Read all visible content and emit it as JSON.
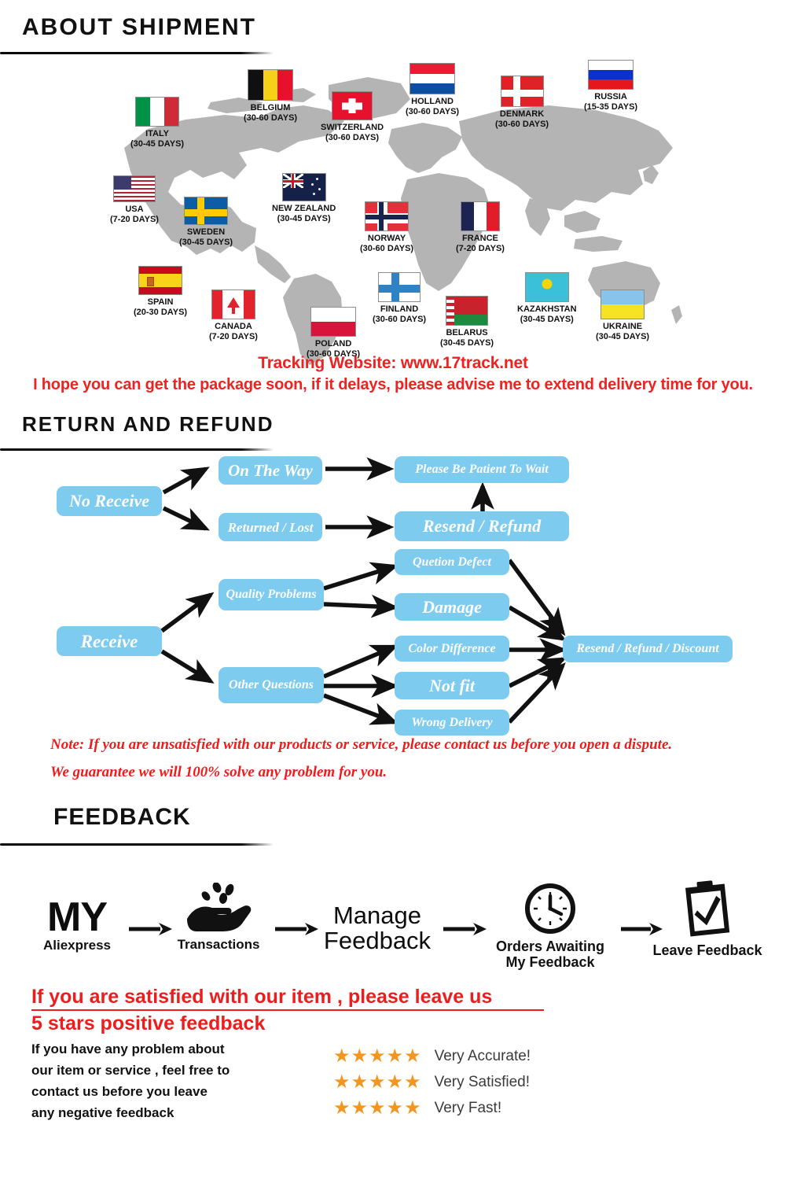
{
  "sections": {
    "shipment_title": "ABOUT  SHIPMENT",
    "return_title": "RETURN  AND  REFUND",
    "feedback_title": "FEEDBACK"
  },
  "shipment": {
    "tracking_line": "Tracking Website: www.17track.net",
    "hope_line": "I hope you can get the package soon, if it delays, please advise me to extend delivery time for you.",
    "destinations": [
      {
        "country": "ITALY",
        "days": "(30-45 DAYS)",
        "flag": "italy-flag"
      },
      {
        "country": "BELGIUM",
        "days": "(30-60 DAYS)",
        "flag": "belgium-flag"
      },
      {
        "country": "SWITZERLAND",
        "days": "(30-60 DAYS)",
        "flag": "switzerland-flag"
      },
      {
        "country": "HOLLAND",
        "days": "(30-60 DAYS)",
        "flag": "holland-flag"
      },
      {
        "country": "DENMARK",
        "days": "(30-60 DAYS)",
        "flag": "denmark-flag"
      },
      {
        "country": "RUSSIA",
        "days": "(15-35 DAYS)",
        "flag": "russia-flag"
      },
      {
        "country": "USA",
        "days": "(7-20 DAYS)",
        "flag": "usa-flag"
      },
      {
        "country": "SWEDEN",
        "days": "(30-45 DAYS)",
        "flag": "sweden-flag"
      },
      {
        "country": "NEW ZEALAND",
        "days": "(30-45 DAYS)",
        "flag": "new-zealand-flag"
      },
      {
        "country": "NORWAY",
        "days": "(30-60 DAYS)",
        "flag": "norway-flag"
      },
      {
        "country": "FRANCE",
        "days": "(7-20 DAYS)",
        "flag": "france-flag"
      },
      {
        "country": "SPAIN",
        "days": "(20-30 DAYS)",
        "flag": "spain-flag"
      },
      {
        "country": "CANADA",
        "days": "(7-20 DAYS)",
        "flag": "canada-flag"
      },
      {
        "country": "POLAND",
        "days": "(30-60 DAYS)",
        "flag": "poland-flag"
      },
      {
        "country": "FINLAND",
        "days": "(30-60 DAYS)",
        "flag": "finland-flag"
      },
      {
        "country": "BELARUS",
        "days": "(30-45 DAYS)",
        "flag": "belarus-flag"
      },
      {
        "country": "KAZAKHSTAN",
        "days": "(30-45 DAYS)",
        "flag": "kazakhstan-flag"
      },
      {
        "country": "UKRAINE",
        "days": "(30-45 DAYS)",
        "flag": "ukraine-flag"
      }
    ]
  },
  "flowchart": {
    "nodes": {
      "no_receive": "No Receive",
      "on_the_way": "On The Way",
      "returned_lost": "Returned / Lost",
      "please_wait": "Please Be Patient To Wait",
      "resend_refund": "Resend / Refund",
      "receive": "Receive",
      "quality_problems": "Quality Problems",
      "other_questions": "Other Questions",
      "quetion_defect": "Quetion Defect",
      "damage": "Damage",
      "color_difference": "Color Difference",
      "not_fit": "Not fit",
      "wrong_delivery": "Wrong Delivery",
      "resend_refund_discount": "Resend / Refund / Discount"
    },
    "note_line1": "Note: If you are unsatisfied with our products or service, please contact us before you open a dispute.",
    "note_line2": "We guarantee we will 100% solve any problem for you."
  },
  "feedback": {
    "steps": [
      {
        "big": "MY",
        "caption": "Aliexpress",
        "icon": "my-aliexpress-logo"
      },
      {
        "big": "",
        "caption": "Transactions",
        "icon": "hand-coins-icon"
      },
      {
        "big": "Manage",
        "caption": "Feedback",
        "icon": "manage-feedback-text"
      },
      {
        "big": "",
        "caption": "Orders Awaiting\nMy Feedback",
        "icon": "clock-icon"
      },
      {
        "big": "",
        "caption": "Leave Feedback",
        "icon": "clipboard-check-icon"
      }
    ],
    "headline_line1": "If you are satisfied with our item , please leave us",
    "headline_line2": "5 stars positive feedback",
    "paragraph": [
      "If you have any problem about",
      "our item or service , feel free to",
      "contact us before you  leave",
      "any negative feedback"
    ],
    "ratings": [
      {
        "stars": "★★★★★",
        "label": "Very Accurate!"
      },
      {
        "stars": "★★★★★",
        "label": "Very Satisfied!"
      },
      {
        "stars": "★★★★★",
        "label": "Very Fast!"
      }
    ]
  },
  "colors": {
    "node_blue": "#7ecbf0",
    "red": "#ee1d1d",
    "star_orange": "#f29620",
    "map_gray": "#b3b3b3"
  }
}
